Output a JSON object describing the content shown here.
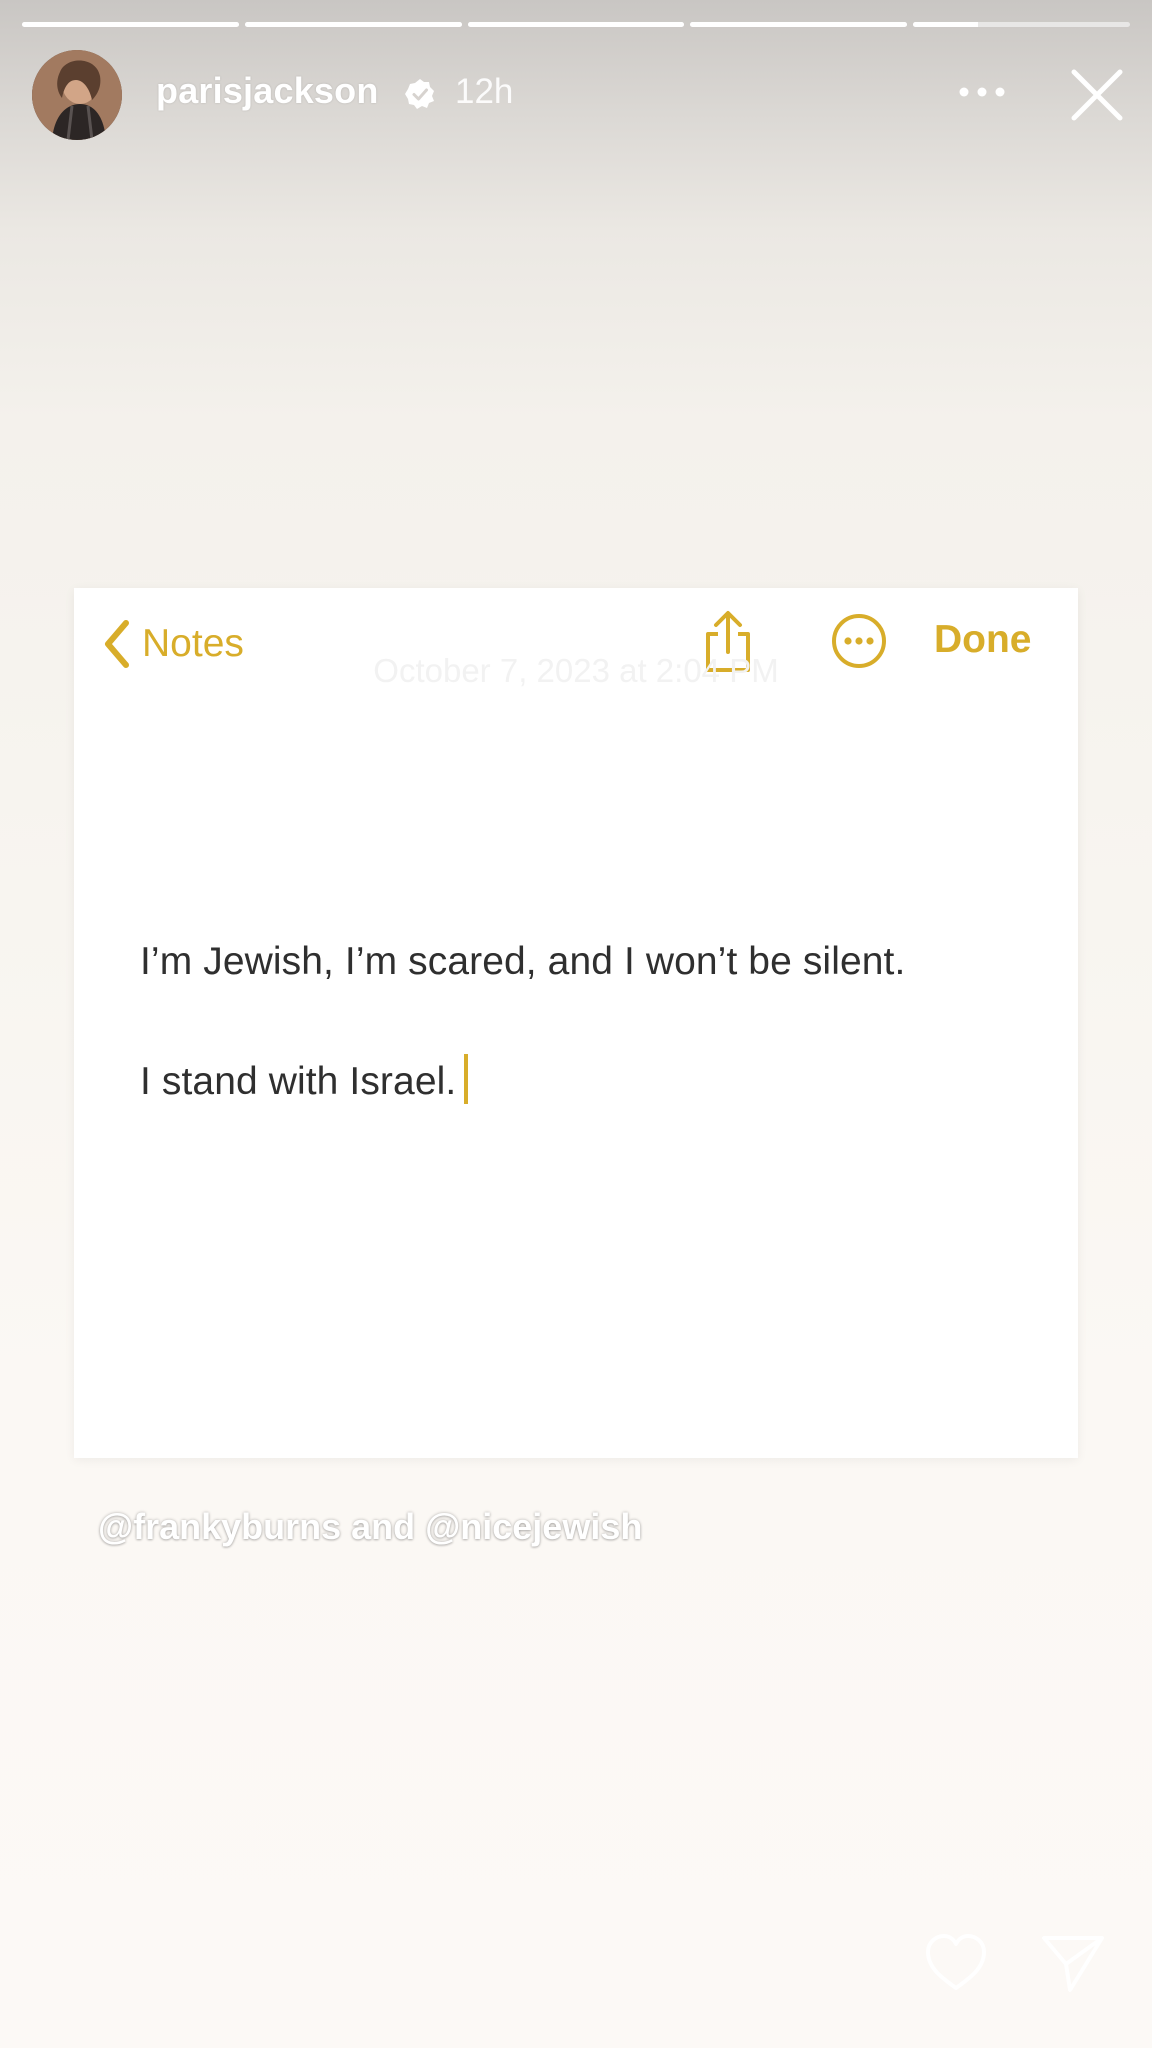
{
  "story": {
    "progress": [
      1,
      1,
      1,
      1,
      0.3
    ],
    "account": {
      "username": "parisjackson",
      "verified": true,
      "time_ago": "12h"
    },
    "icons": {
      "more": "more-horizontal-icon",
      "close": "close-icon",
      "like": "heart-icon",
      "send": "send-icon"
    }
  },
  "note": {
    "back_label": "Notes",
    "done_label": "Done",
    "date_text": "October 7, 2023 at 2:04 PM",
    "lines": [
      "I’m Jewish, I’m scared, and I won’t be silent.",
      "I stand with Israel."
    ],
    "accent_color": "#d8ad2a"
  },
  "caption": {
    "mentions": "@frankyburns and @nicejewish"
  }
}
